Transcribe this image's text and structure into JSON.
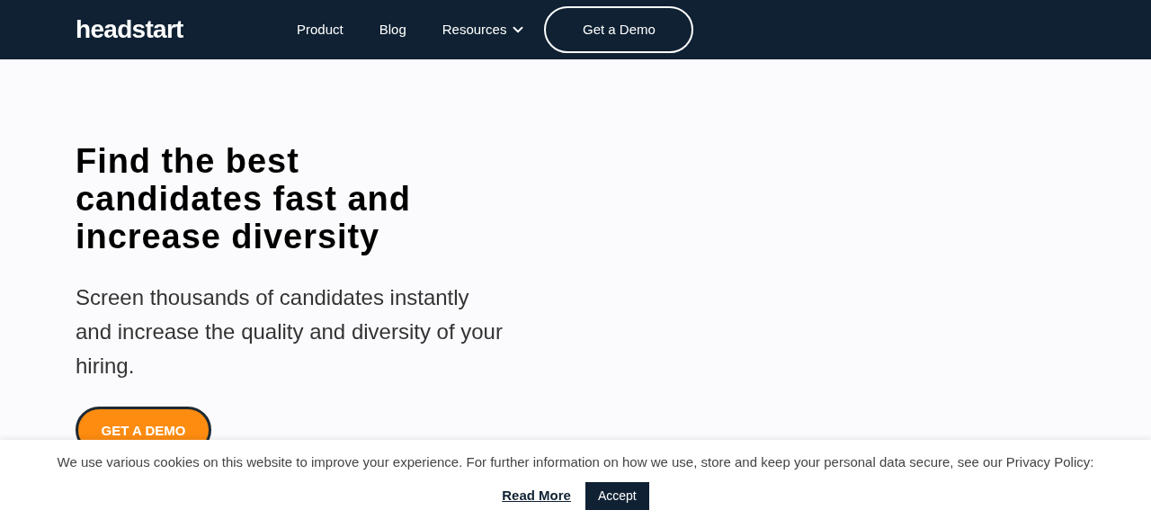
{
  "nav": {
    "logo": "headstart",
    "links": [
      {
        "label": "Product",
        "dropdown": false
      },
      {
        "label": "Blog",
        "dropdown": false
      },
      {
        "label": "Resources",
        "dropdown": true
      }
    ],
    "cta": "Get a Demo"
  },
  "hero": {
    "title": "Find the best candidates fast and increase diversity",
    "subtitle": "Screen thousands of candidates instantly and increase the quality and diversity of your hiring.",
    "cta": "GET A DEMO"
  },
  "cookie_banner": {
    "text": "We use various cookies on this website to improve your experience. For further information on how we use, store and keep your personal data secure, see our Privacy Policy:",
    "link": "Read More",
    "button": "Accept"
  }
}
